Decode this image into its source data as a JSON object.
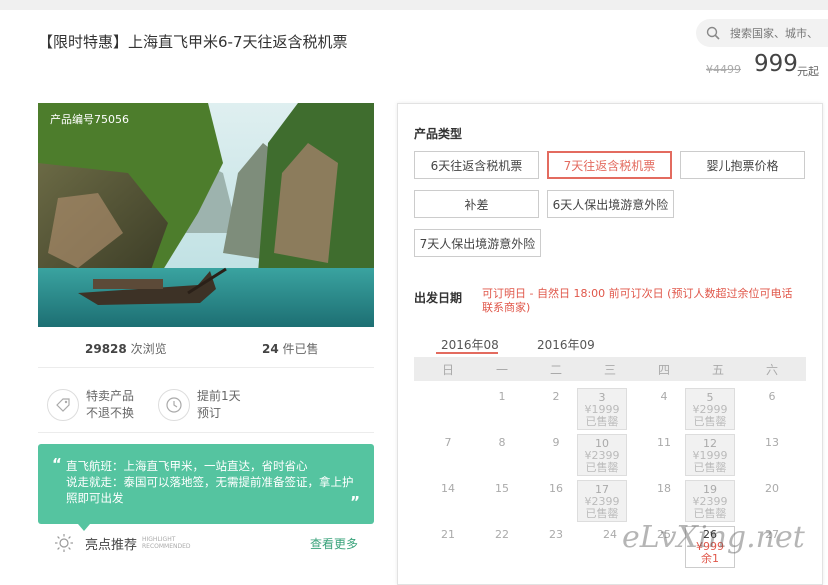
{
  "header": {
    "title": "【限时特惠】上海直飞甲米6-7天往返含税机票",
    "search_placeholder": "搜索国家、城市、"
  },
  "price": {
    "original": "¥4499",
    "current": "999",
    "unit": "元起"
  },
  "product": {
    "code": "产品编号75056",
    "views_count": "29828",
    "views_label": "次浏览",
    "sold_count": "24",
    "sold_label": "件已售"
  },
  "features": [
    {
      "title": "特卖产品",
      "sub": "不退不换",
      "icon": "tag-icon"
    },
    {
      "title": "提前1天",
      "sub": "预订",
      "icon": "clock-icon"
    }
  ],
  "highlight_box": {
    "lines": [
      "直飞航班：上海直飞甲米，一站直达，省时省心",
      "说走就走：泰国可以落地签，无需提前准备签证，拿上护照即可出发"
    ]
  },
  "highlights": {
    "label": "亮点推荐",
    "en1": "HIGHLIGHT",
    "en2": "RECOMMENDED",
    "more": "查看更多"
  },
  "product_type": {
    "label": "产品类型",
    "options": [
      "6天往返含税机票",
      "7天往返含税机票",
      "婴儿抱票价格",
      "补差",
      "6天人保出境游意外险",
      "7天人保出境游意外险"
    ],
    "selected": "7天往返含税机票"
  },
  "departure": {
    "label": "出发日期",
    "note": "可订明日 - 自然日 18:00 前可订次日   (预订人数超过余位可电话联系商家)",
    "months": [
      "2016年08",
      "2016年09"
    ],
    "active_month": "2016年08",
    "weekdays": [
      "日",
      "一",
      "二",
      "三",
      "四",
      "五",
      "六"
    ],
    "rows": [
      [
        {
          "d": ""
        },
        {
          "d": "1"
        },
        {
          "d": "2"
        },
        {
          "d": "3",
          "p": "¥1999",
          "s": "已售罄"
        },
        {
          "d": "4"
        },
        {
          "d": "5",
          "p": "¥2999",
          "s": "已售罄"
        },
        {
          "d": "6"
        }
      ],
      [
        {
          "d": "7"
        },
        {
          "d": "8"
        },
        {
          "d": "9"
        },
        {
          "d": "10",
          "p": "¥2399",
          "s": "已售罄"
        },
        {
          "d": "11"
        },
        {
          "d": "12",
          "p": "¥1999",
          "s": "已售罄"
        },
        {
          "d": "13"
        }
      ],
      [
        {
          "d": "14"
        },
        {
          "d": "15"
        },
        {
          "d": "16"
        },
        {
          "d": "17",
          "p": "¥2399",
          "s": "已售罄"
        },
        {
          "d": "18"
        },
        {
          "d": "19",
          "p": "¥2399",
          "s": "已售罄"
        },
        {
          "d": "20"
        }
      ],
      [
        {
          "d": "21"
        },
        {
          "d": "22"
        },
        {
          "d": "23"
        },
        {
          "d": "24"
        },
        {
          "d": "25"
        },
        {
          "d": "26",
          "p": "¥999",
          "s": "余1",
          "avail": true
        },
        {
          "d": "27"
        }
      ]
    ]
  },
  "watermark": "eLvXing.net",
  "colors": {
    "accent": "#e36b5f",
    "green": "#55c4a0",
    "link": "#3aa37b"
  }
}
